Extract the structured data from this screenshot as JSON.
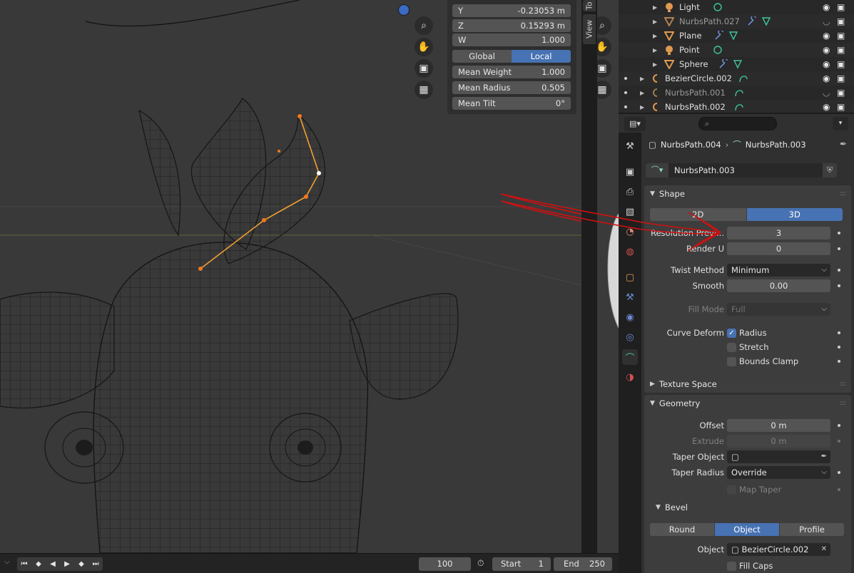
{
  "n_panel": {
    "y_label": "Y",
    "y_value": "-0.23053 m",
    "z_label": "Z",
    "z_value": "0.15293 m",
    "w_label": "W",
    "w_value": "1.000",
    "space_global": "Global",
    "space_local": "Local",
    "mean_weight_label": "Mean Weight",
    "mean_weight_value": "1.000",
    "mean_radius_label": "Mean Radius",
    "mean_radius_value": "0.505",
    "mean_tilt_label": "Mean Tilt",
    "mean_tilt_value": "0°"
  },
  "side_tabs": {
    "tool": "To",
    "view": "View"
  },
  "outliner": {
    "rows": [
      {
        "name": "Light",
        "type": "light",
        "dim": false
      },
      {
        "name": "NurbsPath.027",
        "type": "mesh",
        "dim": true
      },
      {
        "name": "Plane",
        "type": "mesh",
        "dim": false
      },
      {
        "name": "Point",
        "type": "light",
        "dim": false
      },
      {
        "name": "Sphere",
        "type": "mesh",
        "dim": false
      },
      {
        "name": "BezierCircle.002",
        "type": "curve",
        "dim": false
      },
      {
        "name": "NurbsPath.001",
        "type": "curve",
        "dim": true
      },
      {
        "name": "NurbsPath.002",
        "type": "curve",
        "dim": false
      }
    ]
  },
  "properties": {
    "search_placeholder": "",
    "breadcrumb_object": "NurbsPath.004",
    "breadcrumb_data": "NurbsPath.003",
    "datablock_name": "NurbsPath.003",
    "shape": {
      "title": "Shape",
      "mode_2d": "2D",
      "mode_3d": "3D",
      "resolution_preview_label": "Resolution Previ...",
      "resolution_preview_value": "3",
      "render_u_label": "Render U",
      "render_u_value": "0",
      "twist_method_label": "Twist Method",
      "twist_method_value": "Minimum",
      "smooth_label": "Smooth",
      "smooth_value": "0.00",
      "fill_mode_label": "Fill Mode",
      "fill_mode_value": "Full",
      "curve_deform_label": "Curve Deform",
      "radius_label": "Radius",
      "stretch_label": "Stretch",
      "bounds_clamp_label": "Bounds Clamp"
    },
    "texture_space": {
      "title": "Texture Space"
    },
    "geometry": {
      "title": "Geometry",
      "offset_label": "Offset",
      "offset_value": "0 m",
      "extrude_label": "Extrude",
      "extrude_value": "0 m",
      "taper_object_label": "Taper Object",
      "taper_radius_label": "Taper Radius",
      "taper_radius_value": "Override",
      "map_taper_label": "Map Taper"
    },
    "bevel": {
      "title": "Bevel",
      "mode_round": "Round",
      "mode_object": "Object",
      "mode_profile": "Profile",
      "object_label": "Object",
      "object_value": "BezierCircle.002",
      "fill_caps_label": "Fill Caps"
    }
  },
  "timeline": {
    "current_frame": "100",
    "start_label": "Start",
    "start_value": "1",
    "end_label": "End",
    "end_value": "250"
  },
  "colors": {
    "accent": "#4772b3",
    "selection": "#f0a030",
    "annotation": "#d01010"
  }
}
